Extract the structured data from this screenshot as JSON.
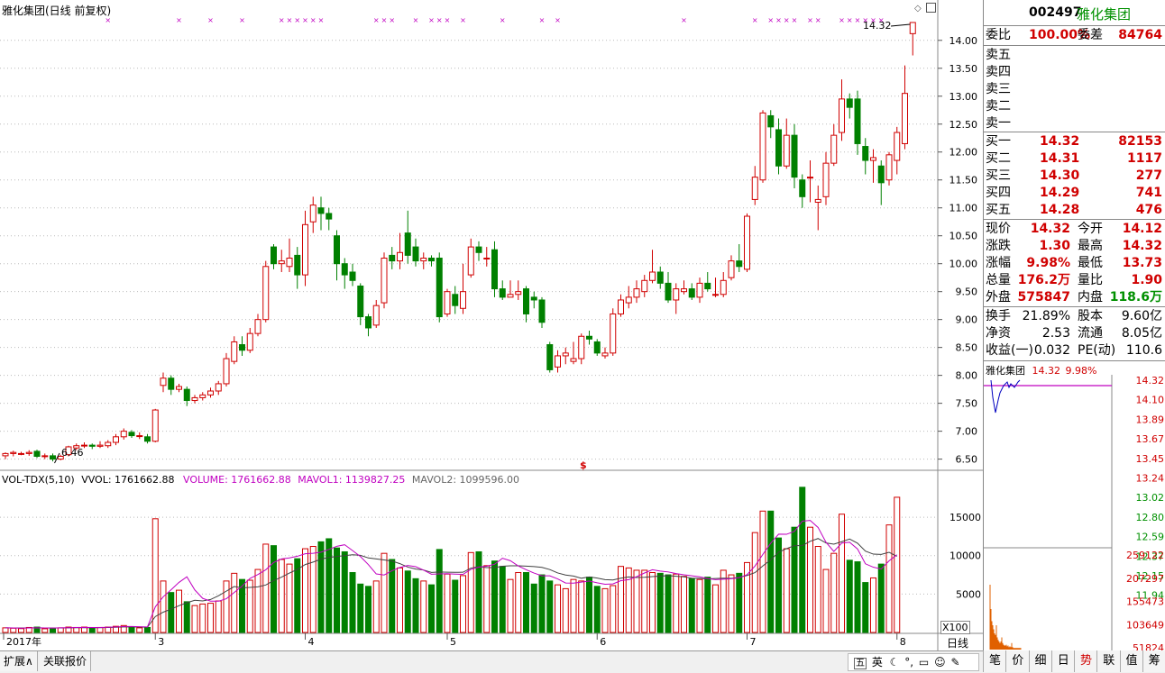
{
  "chart_title": "雅化集团(日线 前复权)",
  "chart_data": {
    "type": "candlestick",
    "price_axis_ticks": [
      "14.00",
      "13.50",
      "13.00",
      "12.50",
      "12.00",
      "11.50",
      "11.00",
      "10.50",
      "10.00",
      "9.50",
      "9.00",
      "8.50",
      "8.00",
      "7.50",
      "7.00",
      "6.50"
    ],
    "price_range": [
      6.3,
      14.4
    ],
    "x_axis_labels": [
      "2017年",
      "3",
      "4",
      "5",
      "6",
      "7",
      "8"
    ],
    "high_label": "14.32",
    "low_label": "6.46",
    "candles": [
      [
        6.56,
        6.6,
        6.62,
        6.5
      ],
      [
        6.6,
        6.62,
        6.65,
        6.55
      ],
      [
        6.6,
        6.6,
        6.63,
        6.57
      ],
      [
        6.6,
        6.62,
        6.66,
        6.56
      ],
      [
        6.64,
        6.55,
        6.67,
        6.52
      ],
      [
        6.55,
        6.56,
        6.6,
        6.5
      ],
      [
        6.56,
        6.5,
        6.6,
        6.46
      ],
      [
        6.5,
        6.55,
        6.58,
        6.48
      ],
      [
        6.58,
        6.72,
        6.74,
        6.55
      ],
      [
        6.7,
        6.74,
        6.78,
        6.66
      ],
      [
        6.74,
        6.75,
        6.8,
        6.7
      ],
      [
        6.75,
        6.73,
        6.78,
        6.68
      ],
      [
        6.73,
        6.75,
        6.82,
        6.7
      ],
      [
        6.74,
        6.8,
        6.84,
        6.7
      ],
      [
        6.8,
        6.9,
        6.95,
        6.75
      ],
      [
        6.9,
        7.0,
        7.05,
        6.85
      ],
      [
        6.98,
        6.92,
        7.02,
        6.88
      ],
      [
        6.92,
        6.92,
        6.98,
        6.86
      ],
      [
        6.9,
        6.82,
        6.95,
        6.78
      ],
      [
        6.82,
        7.38,
        7.4,
        6.8
      ],
      [
        7.82,
        7.95,
        8.05,
        7.7
      ],
      [
        7.95,
        7.75,
        8.0,
        7.65
      ],
      [
        7.75,
        7.8,
        7.85,
        7.7
      ],
      [
        7.75,
        7.55,
        7.8,
        7.45
      ],
      [
        7.55,
        7.6,
        7.65,
        7.5
      ],
      [
        7.6,
        7.65,
        7.7,
        7.55
      ],
      [
        7.65,
        7.72,
        7.78,
        7.6
      ],
      [
        7.72,
        7.85,
        7.9,
        7.65
      ],
      [
        7.85,
        8.3,
        8.4,
        7.8
      ],
      [
        8.25,
        8.6,
        8.7,
        8.2
      ],
      [
        8.55,
        8.45,
        8.7,
        8.35
      ],
      [
        8.45,
        8.75,
        8.85,
        8.4
      ],
      [
        8.75,
        9.0,
        9.1,
        8.7
      ],
      [
        9.0,
        9.95,
        10.05,
        8.95
      ],
      [
        10.3,
        10.0,
        10.35,
        9.9
      ],
      [
        10.0,
        10.05,
        10.25,
        9.85
      ],
      [
        9.95,
        10.1,
        10.45,
        9.85
      ],
      [
        10.15,
        9.8,
        10.3,
        9.55
      ],
      [
        9.8,
        10.7,
        10.95,
        9.6
      ],
      [
        10.75,
        11.05,
        11.2,
        10.55
      ],
      [
        11.0,
        10.9,
        11.2,
        10.6
      ],
      [
        10.9,
        10.8,
        11.0,
        10.6
      ],
      [
        10.5,
        10.0,
        10.6,
        9.7
      ],
      [
        10.0,
        9.8,
        10.1,
        9.55
      ],
      [
        9.85,
        9.7,
        10.0,
        9.6
      ],
      [
        9.6,
        9.05,
        9.65,
        8.9
      ],
      [
        9.05,
        8.85,
        9.1,
        8.7
      ],
      [
        8.9,
        9.25,
        9.35,
        8.85
      ],
      [
        9.3,
        10.1,
        10.2,
        9.2
      ],
      [
        10.15,
        10.05,
        10.3,
        9.9
      ],
      [
        10.05,
        10.2,
        10.55,
        9.9
      ],
      [
        10.55,
        10.15,
        10.95,
        10.0
      ],
      [
        10.3,
        10.05,
        10.45,
        9.95
      ],
      [
        10.05,
        10.1,
        10.2,
        9.9
      ],
      [
        10.1,
        10.05,
        10.15,
        9.95
      ],
      [
        10.1,
        9.05,
        10.2,
        8.95
      ],
      [
        9.1,
        9.5,
        9.55,
        9.05
      ],
      [
        9.45,
        9.25,
        9.6,
        9.1
      ],
      [
        9.2,
        9.5,
        10.0,
        9.1
      ],
      [
        9.8,
        10.3,
        10.45,
        9.75
      ],
      [
        10.3,
        10.2,
        10.4,
        10.05
      ],
      [
        10.1,
        10.1,
        10.3,
        9.95
      ],
      [
        10.25,
        9.55,
        10.4,
        9.4
      ],
      [
        9.55,
        9.4,
        9.7,
        9.35
      ],
      [
        9.4,
        9.45,
        9.7,
        9.4
      ],
      [
        9.45,
        9.5,
        9.7,
        9.35
      ],
      [
        9.55,
        9.1,
        9.6,
        8.95
      ],
      [
        9.4,
        9.35,
        9.5,
        9.2
      ],
      [
        9.35,
        8.95,
        9.4,
        8.85
      ],
      [
        8.55,
        8.1,
        8.6,
        8.05
      ],
      [
        8.15,
        8.35,
        8.45,
        8.05
      ],
      [
        8.35,
        8.4,
        8.5,
        8.2
      ],
      [
        8.25,
        8.3,
        8.6,
        8.2
      ],
      [
        8.3,
        8.7,
        8.75,
        8.2
      ],
      [
        8.7,
        8.65,
        8.8,
        8.55
      ],
      [
        8.6,
        8.4,
        8.65,
        8.35
      ],
      [
        8.35,
        8.4,
        8.5,
        8.3
      ],
      [
        8.4,
        9.1,
        9.2,
        8.35
      ],
      [
        9.1,
        9.35,
        9.45,
        9.05
      ],
      [
        9.3,
        9.4,
        9.6,
        9.2
      ],
      [
        9.4,
        9.55,
        9.7,
        9.3
      ],
      [
        9.5,
        9.7,
        9.8,
        9.4
      ],
      [
        9.7,
        9.85,
        10.25,
        9.65
      ],
      [
        9.85,
        9.65,
        9.95,
        9.55
      ],
      [
        9.65,
        9.35,
        9.85,
        9.3
      ],
      [
        9.35,
        9.55,
        9.65,
        9.1
      ],
      [
        9.5,
        9.55,
        9.7,
        9.45
      ],
      [
        9.55,
        9.4,
        9.65,
        9.35
      ],
      [
        9.4,
        9.65,
        9.75,
        9.3
      ],
      [
        9.65,
        9.55,
        9.85,
        9.5
      ],
      [
        9.45,
        9.45,
        9.75,
        9.4
      ],
      [
        9.45,
        9.7,
        9.85,
        9.4
      ],
      [
        9.75,
        10.05,
        10.15,
        9.7
      ],
      [
        10.05,
        9.95,
        10.35,
        9.85
      ],
      [
        9.9,
        10.85,
        10.9,
        9.85
      ],
      [
        11.15,
        11.55,
        11.75,
        11.05
      ],
      [
        11.5,
        12.7,
        12.75,
        11.45
      ],
      [
        12.65,
        12.45,
        12.75,
        12.25
      ],
      [
        12.4,
        11.75,
        12.6,
        11.6
      ],
      [
        11.75,
        12.3,
        12.6,
        11.7
      ],
      [
        12.3,
        11.55,
        12.5,
        11.35
      ],
      [
        11.5,
        11.2,
        11.6,
        11.0
      ],
      [
        11.55,
        11.55,
        11.85,
        11.1
      ],
      [
        11.1,
        11.15,
        11.4,
        10.6
      ],
      [
        11.2,
        11.8,
        12.0,
        11.05
      ],
      [
        11.8,
        12.3,
        12.5,
        11.75
      ],
      [
        12.35,
        12.95,
        13.3,
        12.2
      ],
      [
        12.95,
        12.8,
        13.05,
        12.6
      ],
      [
        12.95,
        12.15,
        13.1,
        11.95
      ],
      [
        12.1,
        11.85,
        12.25,
        11.6
      ],
      [
        11.85,
        11.9,
        12.05,
        11.45
      ],
      [
        11.75,
        11.45,
        11.85,
        11.05
      ],
      [
        11.5,
        11.95,
        12.0,
        11.4
      ],
      [
        11.85,
        12.35,
        12.45,
        11.6
      ],
      [
        12.15,
        13.05,
        13.55,
        12.05
      ],
      [
        14.12,
        14.32,
        14.32,
        13.73
      ]
    ],
    "dashed_level": 11.95,
    "vol_title": "VOL-TDX(5,10)",
    "vol_vvol": "VVOL: 1761662.88",
    "vol_volume": "VOLUME: 1761662.88",
    "vol_mavol1": "MAVOL1: 1139827.25",
    "vol_mavol2": "MAVOL2: 1099596.00",
    "vol_axis_ticks": [
      "15000",
      "10000",
      "5000"
    ],
    "vol_unit": "X100",
    "vol_range": [
      0,
      19000
    ],
    "volumes": [
      600,
      550,
      500,
      650,
      700,
      480,
      520,
      600,
      700,
      650,
      700,
      600,
      650,
      700,
      800,
      900,
      700,
      600,
      650,
      14800,
      6700,
      5200,
      5500,
      4000,
      3500,
      3700,
      3800,
      4100,
      6700,
      7700,
      6900,
      6800,
      8200,
      11500,
      11300,
      9500,
      8900,
      9600,
      10900,
      11200,
      11800,
      12200,
      11000,
      10500,
      7800,
      6300,
      6000,
      6700,
      10300,
      9500,
      8400,
      8000,
      7000,
      6700,
      6200,
      10800,
      7600,
      6800,
      7400,
      10400,
      10500,
      8700,
      9300,
      8600,
      6900,
      7800,
      7800,
      6300,
      7500,
      6700,
      6200,
      5700,
      6900,
      6700,
      7200,
      6000,
      5700,
      6100,
      8600,
      8400,
      8100,
      8100,
      7800,
      7700,
      7500,
      7600,
      7300,
      7000,
      6900,
      7200,
      6200,
      8100,
      7500,
      7700,
      9100,
      13000,
      15800,
      15800,
      12300,
      10900,
      13700,
      18900,
      13700,
      11200,
      8200,
      10300,
      15400,
      9400,
      9200,
      6500,
      7100,
      8900,
      14000,
      17600
    ],
    "ma5": [
      600,
      580,
      560,
      580,
      600,
      580,
      570,
      600,
      620,
      640,
      660,
      640,
      650,
      670,
      720,
      770,
      770,
      750,
      720,
      3340,
      4640,
      5560,
      6520,
      7240,
      5540,
      4440,
      4080,
      4070,
      4390,
      5200,
      6040,
      7030,
      7540,
      8160,
      9110,
      9570,
      9700,
      9920,
      10250,
      10300,
      10450,
      10810,
      11220,
      11420,
      10660,
      9880,
      8830,
      7620,
      7480,
      8040,
      8460,
      8720,
      8560,
      8120,
      7580,
      7620,
      7660,
      7600,
      7560,
      8220,
      8500,
      8620,
      8880,
      9660,
      9340,
      8660,
      8170,
      7730,
      7380,
      7370,
      6970,
      6440,
      6420,
      6550,
      6700,
      6460,
      6270,
      6320,
      6740,
      6880,
      7260,
      7740,
      8160,
      7990,
      7880,
      7670,
      7510,
      7380,
      7240,
      7020,
      6880,
      6940,
      7000,
      7120,
      7530,
      8640,
      10160,
      11620,
      12800,
      12780,
      13160,
      14490,
      14580,
      13670,
      11750,
      10540,
      11640,
      11740,
      10870,
      8940,
      8500,
      8260,
      9320,
      10120
    ],
    "ma10": [
      600,
      590,
      580,
      590,
      600,
      590,
      580,
      590,
      600,
      620,
      630,
      610,
      620,
      640,
      680,
      720,
      720,
      700,
      690,
      2070,
      2640,
      3040,
      3480,
      3870,
      4190,
      4110,
      4290,
      4770,
      5380,
      5980,
      5800,
      5860,
      5940,
      6180,
      6750,
      7210,
      7730,
      8210,
      8840,
      9160,
      9540,
      9770,
      9890,
      10000,
      10110,
      10040,
      9700,
      9580,
      9440,
      9290,
      8960,
      8510,
      8250,
      8130,
      7810,
      7870,
      7840,
      7830,
      7840,
      8380,
      8560,
      8450,
      8450,
      8620,
      8680,
      8680,
      8630,
      8570,
      8470,
      8190,
      7750,
      7480,
      7340,
      7060,
      7230,
      7080,
      6870,
      6830,
      7070,
      7230,
      7150,
      7190,
      7270,
      7330,
      7410,
      7320,
      7240,
      7070,
      7040,
      6980,
      7020,
      7070,
      7040,
      7190,
      7420,
      7790,
      8670,
      9460,
      10450,
      10910,
      11310,
      11310,
      11870,
      12230,
      11650,
      11490,
      11820,
      12160,
      11620,
      10590,
      10200,
      10160,
      10430,
      9920
    ]
  },
  "right_panel": {
    "code": "002497",
    "name": "雅化集团",
    "weibi_label": "委比",
    "weibi_value": "100.00%",
    "weicha_label": "委差",
    "weicha_value": "84764",
    "sell_levels": [
      {
        "label": "卖五"
      },
      {
        "label": "卖四"
      },
      {
        "label": "卖三"
      },
      {
        "label": "卖二"
      },
      {
        "label": "卖一"
      }
    ],
    "buy_levels": [
      {
        "label": "买一",
        "price": "14.32",
        "vol": "82153"
      },
      {
        "label": "买二",
        "price": "14.31",
        "vol": "1117"
      },
      {
        "label": "买三",
        "price": "14.30",
        "vol": "277"
      },
      {
        "label": "买四",
        "price": "14.29",
        "vol": "741"
      },
      {
        "label": "买五",
        "price": "14.28",
        "vol": "476"
      }
    ],
    "quote_rows": [
      {
        "l1": "现价",
        "v1": "14.32",
        "c1": "red",
        "l2": "今开",
        "v2": "14.12",
        "c2": "red"
      },
      {
        "l1": "涨跌",
        "v1": "1.30",
        "c1": "red",
        "l2": "最高",
        "v2": "14.32",
        "c2": "red"
      },
      {
        "l1": "涨幅",
        "v1": "9.98%",
        "c1": "red",
        "l2": "最低",
        "v2": "13.73",
        "c2": "red"
      },
      {
        "l1": "总量",
        "v1": "176.2万",
        "c1": "red",
        "l2": "量比",
        "v2": "1.90",
        "c2": "red"
      },
      {
        "l1": "外盘",
        "v1": "575847",
        "c1": "red",
        "l2": "内盘",
        "v2": "118.6万",
        "c2": "green"
      }
    ],
    "fund_rows": [
      {
        "l1": "换手",
        "v1": "21.89%",
        "l2": "股本",
        "v2": "9.60亿"
      },
      {
        "l1": "净资",
        "v1": "2.53",
        "l2": "流通",
        "v2": "8.05亿"
      },
      {
        "l1": "收益(一)",
        "v1": "0.032",
        "l2": "PE(动)",
        "v2": "110.6"
      }
    ],
    "mini_name": "雅化集团",
    "mini_price": "14.32",
    "mini_pct": "9.98%",
    "mini_price_ticks": [
      "14.32",
      "14.10",
      "13.89",
      "13.67",
      "13.45",
      "13.24",
      "13.02",
      "12.80",
      "12.59",
      "12.37",
      "12.15",
      "11.94"
    ],
    "mini_vol_ticks": [
      "259122",
      "207297",
      "155473",
      "103649",
      "51824"
    ]
  },
  "bottom": {
    "tab_expand": "扩展∧",
    "tab_related": "关联报价",
    "period_label": "日线",
    "ime_items": [
      "五",
      "英"
    ],
    "right_tabs": [
      "笔",
      "价",
      "细",
      "日",
      "势",
      "联",
      "值",
      "筹"
    ]
  },
  "colors": {
    "up": "#d00000",
    "down": "#008000",
    "ma1": "#c000c0",
    "ma2": "#404040"
  }
}
